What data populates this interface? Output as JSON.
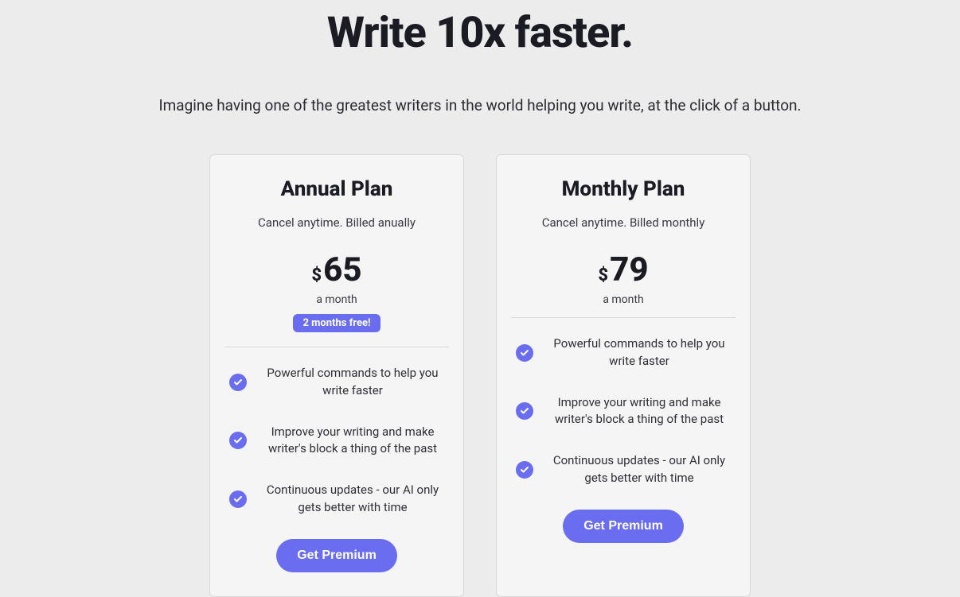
{
  "hero": {
    "title": "Write 10x faster.",
    "subtitle": "Imagine having one of the greatest writers in the world helping you write, at the click of a button."
  },
  "plans": [
    {
      "name": "Annual Plan",
      "billing_note": "Cancel anytime. Billed anually",
      "currency": "$",
      "price": "65",
      "period": "a month",
      "badge": "2 months free!",
      "features": [
        "Powerful commands to help you write faster",
        "Improve your writing and make writer's block a thing of the past",
        "Continuous updates - our AI only gets better with time"
      ],
      "cta": "Get Premium"
    },
    {
      "name": "Monthly Plan",
      "billing_note": "Cancel anytime. Billed monthly",
      "currency": "$",
      "price": "79",
      "period": "a month",
      "badge": null,
      "features": [
        "Powerful commands to help you write faster",
        "Improve your writing and make writer's block a thing of the past",
        "Continuous updates - our AI only gets better with time"
      ],
      "cta": "Get Premium"
    }
  ]
}
